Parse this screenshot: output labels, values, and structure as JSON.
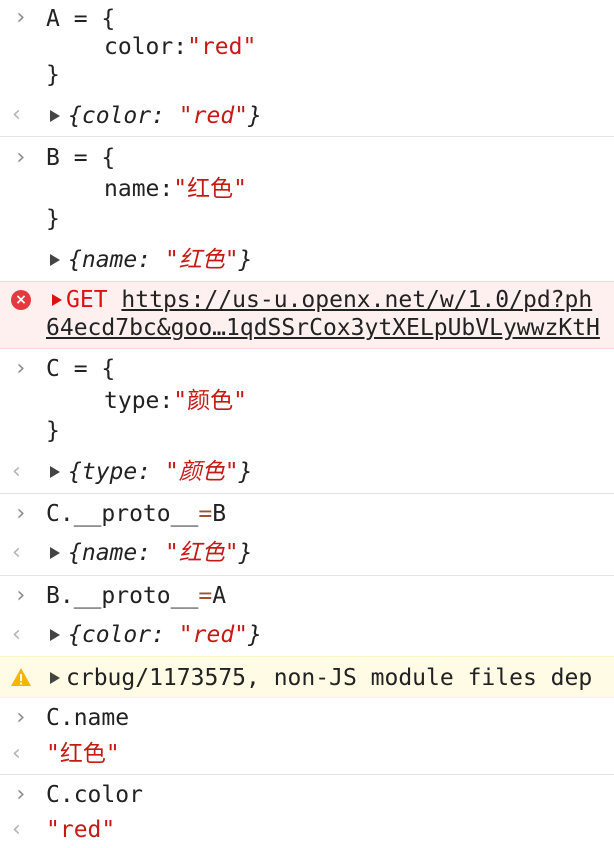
{
  "console": {
    "a_def": {
      "line1": "A = {",
      "prop": "color:",
      "value": "\"red\"",
      "close": "}"
    },
    "a_result": {
      "key": "color: ",
      "value": "\"red\"",
      "brace_open": "{",
      "brace_close": "}"
    },
    "b_def": {
      "line1": "B = {",
      "prop": "name:",
      "value": "\"红色\"",
      "close": "}"
    },
    "b_result": {
      "key": "name: ",
      "value": "\"红色\"",
      "brace_open": "{",
      "brace_close": "}"
    },
    "error": {
      "method": "GET",
      "url_line1": "https://us-u.openx.net/w/1.0/pd?ph",
      "url_line2": "64ecd7bc&goo…1qdSSrCox3ytXELpUbVLywwzKtH"
    },
    "c_def": {
      "line1": "C = {",
      "prop": "type:",
      "value": "\"颜色\"",
      "close": "}"
    },
    "c_result": {
      "key": "type: ",
      "value": "\"颜色\"",
      "brace_open": "{",
      "brace_close": "}"
    },
    "c_proto": {
      "lhs": "C.__proto__",
      "op": "=",
      "rhs": "B"
    },
    "c_proto_result": {
      "key": "name: ",
      "value": "\"红色\"",
      "brace_open": "{",
      "brace_close": "}"
    },
    "b_proto": {
      "lhs": "B.__proto__",
      "op": "=",
      "rhs": "A"
    },
    "b_proto_result": {
      "key": "color: ",
      "value": "\"red\"",
      "brace_open": "{",
      "brace_close": "}"
    },
    "warning": {
      "text": "crbug/1173575, non-JS module files dep"
    },
    "c_name": {
      "input": "C.name",
      "result": "\"红色\""
    },
    "c_color": {
      "input": "C.color",
      "result": "\"red\""
    }
  },
  "colors": {
    "string": "#c41a16",
    "operator": "#a0522d",
    "error_bg": "#fff0f0",
    "warning_bg": "#fffbe5"
  },
  "icons": {
    "prompt": "chevron-right-icon",
    "result": "return-arrow-icon",
    "expand": "triangle-right-icon",
    "error": "error-circle-icon",
    "warning": "warning-triangle-icon"
  },
  "glyphs": {
    "prompt": "›",
    "result": "‹",
    "error_x": "×",
    "warn_mark": "!"
  }
}
